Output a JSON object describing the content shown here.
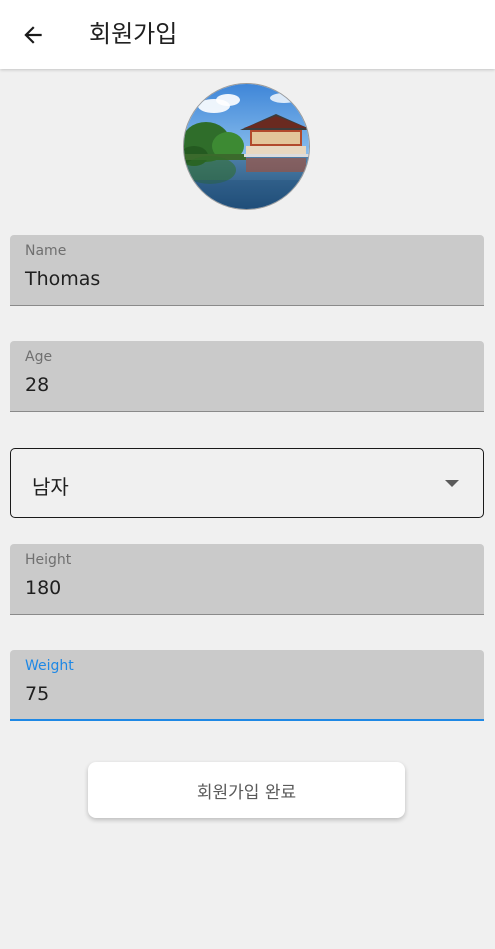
{
  "appbar": {
    "back_icon": "arrow-left-icon",
    "title": "회원가입"
  },
  "avatar": {
    "alt": "Profile photo: pavilion on a lake"
  },
  "form": {
    "name": {
      "label": "Name",
      "value": "Thomas"
    },
    "age": {
      "label": "Age",
      "value": "28"
    },
    "gender": {
      "value": "남자",
      "icon": "caret-down-icon"
    },
    "height": {
      "label": "Height",
      "value": "180"
    },
    "weight": {
      "label": "Weight",
      "value": "75"
    }
  },
  "submit_label": "회원가입 완료",
  "colors": {
    "accent": "#1e88e5",
    "field_bg": "#cacaca",
    "page_bg": "#f0f0f0"
  }
}
